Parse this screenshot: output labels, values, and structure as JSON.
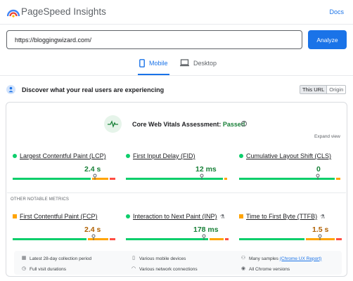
{
  "header": {
    "title": "PageSpeed Insights",
    "docs_label": "Docs"
  },
  "search": {
    "url": "https://bloggingwizard.com/",
    "analyze_label": "Analyze"
  },
  "tabs": [
    {
      "label": "Mobile",
      "active": true
    },
    {
      "label": "Desktop",
      "active": false
    }
  ],
  "discover": {
    "text": "Discover what your real users are experiencing",
    "toggle": [
      "This URL",
      "Origin"
    ],
    "selected": "This URL"
  },
  "assessment": {
    "label": "Core Web Vitals Assessment:",
    "status": "Passed",
    "expand_label": "Expand view"
  },
  "core_metrics": [
    {
      "name": "Largest Contentful Paint (LCP)",
      "value": "2.4 s",
      "rating": "good",
      "distribution_good_fraction": 0.76,
      "distribution_ni_fraction": 0.16,
      "marker_fraction": 0.8
    },
    {
      "name": "First Input Delay (FID)",
      "value": "12 ms",
      "rating": "good",
      "distribution_good_fraction": 0.95,
      "distribution_ni_fraction": 0.03,
      "marker_fraction": 0.74
    },
    {
      "name": "Cumulative Layout Shift (CLS)",
      "value": "0",
      "rating": "good",
      "distribution_good_fraction": 0.93,
      "distribution_ni_fraction": 0.04,
      "marker_fraction": 0.77
    }
  ],
  "notable_heading": "OTHER NOTABLE METRICS",
  "other_metrics": [
    {
      "name": "First Contentful Paint (FCP)",
      "value": "2.4 s",
      "rating": "average",
      "experimental": false,
      "distribution_good_fraction": 0.72,
      "distribution_ni_fraction": 0.2,
      "marker_fraction": 0.79
    },
    {
      "name": "Interaction to Next Paint (INP)",
      "value": "178 ms",
      "rating": "good",
      "experimental": true,
      "distribution_good_fraction": 0.8,
      "distribution_ni_fraction": 0.14,
      "marker_fraction": 0.76
    },
    {
      "name": "Time to First Byte (TTFB)",
      "value": "1.5 s",
      "rating": "average",
      "experimental": true,
      "distribution_good_fraction": 0.64,
      "distribution_ni_fraction": 0.28,
      "marker_fraction": 0.79
    }
  ],
  "footer": {
    "items": [
      {
        "icon": "calendar-icon",
        "text": "Latest 28-day collection period"
      },
      {
        "icon": "phone-icon",
        "text": "Various mobile devices"
      },
      {
        "icon": "users-icon",
        "text": "Many samples",
        "link": "(Chrome UX Report)"
      },
      {
        "icon": "clock-icon",
        "text": "Full visit durations"
      },
      {
        "icon": "wifi-icon",
        "text": "Various network connections"
      },
      {
        "icon": "chrome-icon",
        "text": "All Chrome versions"
      }
    ]
  },
  "colors": {
    "good": "#0cce6b",
    "average": "#ffa400",
    "poor": "#ff4e42",
    "accent": "#1a73e8"
  }
}
